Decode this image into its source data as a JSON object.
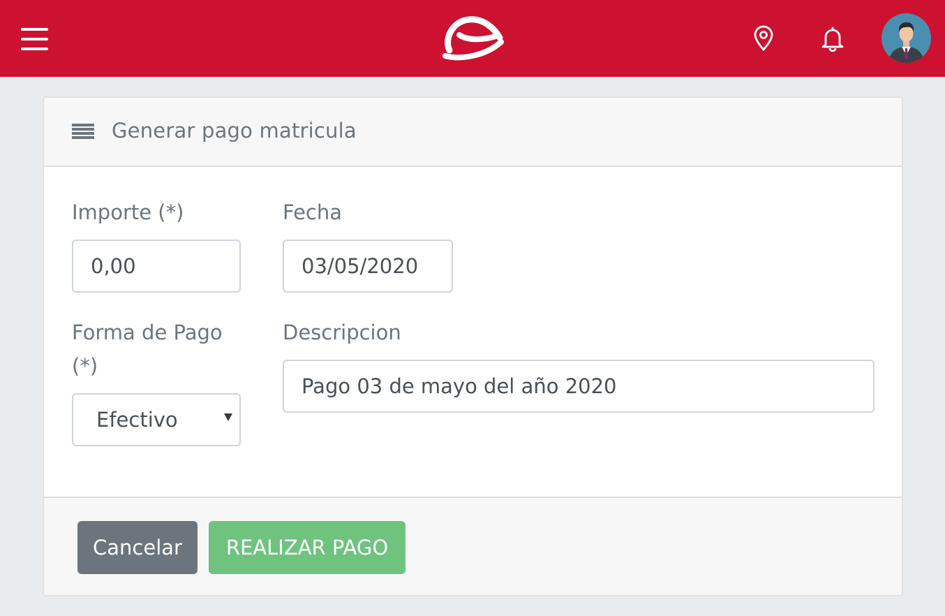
{
  "header": {
    "brand_color": "#cc1230",
    "icons": [
      "hamburger-menu-icon",
      "brand-logo",
      "map-pin-icon",
      "bell-icon",
      "user-avatar"
    ]
  },
  "card": {
    "title": "Generar pago matricula",
    "title_icon": "list-icon",
    "fields": {
      "importe": {
        "label": "Importe (*)",
        "value": "0,00"
      },
      "fecha": {
        "label": "Fecha",
        "value": "03/05/2020"
      },
      "forma_pago": {
        "label_line1": "Forma de Pago",
        "label_line2": "(*)",
        "value": "Efectivo"
      },
      "descripcion": {
        "label": "Descripcion",
        "value": "Pago 03 de mayo del año 2020"
      }
    },
    "buttons": {
      "cancel": "Cancelar",
      "submit": "REALIZAR PAGO"
    }
  },
  "colors": {
    "cancel_button": "#6c757d",
    "submit_button": "#6fc37f",
    "page_background": "#e9ecef"
  }
}
